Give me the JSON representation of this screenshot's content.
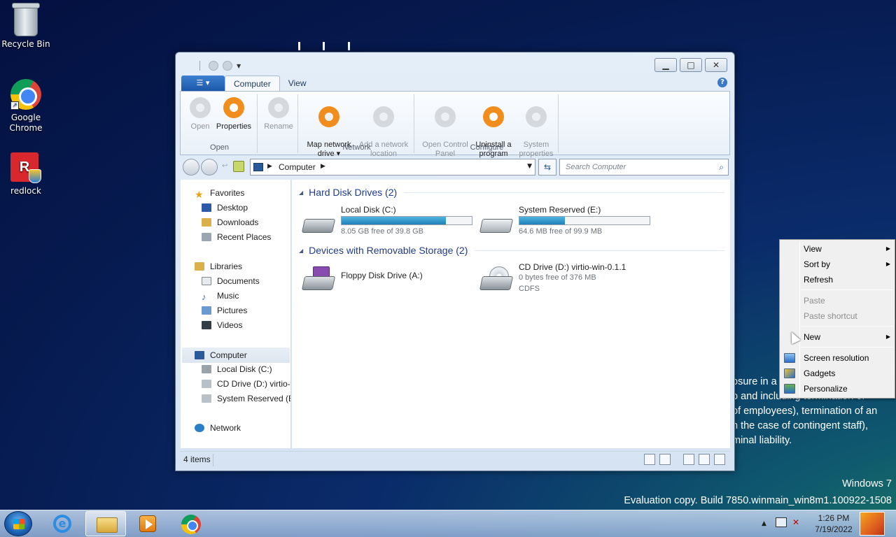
{
  "desktop": {
    "icons": [
      {
        "label": "Recycle Bin",
        "icon": "recycle-bin-icon"
      },
      {
        "label": "Google\nChrome",
        "icon": "chrome-icon"
      },
      {
        "label": "redlock",
        "icon": "redlock-icon"
      }
    ],
    "legal_text": [
      "osure in a",
      "o and including termination of",
      "of employees), termination of an",
      "n the case of contingent staff),",
      "minal liability."
    ],
    "watermark": {
      "line1": "Windows 7",
      "line2": "Evaluation copy. Build 7850.winmain_win8m1.100922-1508"
    }
  },
  "window": {
    "tabs": {
      "file": "▾",
      "computer": "Computer",
      "view": "View"
    },
    "ribbon": {
      "groups": [
        {
          "label": "Open",
          "buttons": [
            "Open",
            "Properties"
          ]
        },
        {
          "label": "",
          "buttons": [
            "Rename"
          ]
        },
        {
          "label": "Network",
          "buttons": [
            "Map network\ndrive ▾",
            "Add a network\nlocation"
          ]
        },
        {
          "label": "Configure",
          "buttons": [
            "Open Control\nPanel",
            "Uninstall a\nprogram",
            "System\nproperties"
          ]
        }
      ]
    },
    "address": {
      "path": "Computer",
      "search_placeholder": "Search Computer"
    },
    "nav": {
      "favorites": "Favorites",
      "desktop": "Desktop",
      "downloads": "Downloads",
      "recent": "Recent Places",
      "libraries": "Libraries",
      "documents": "Documents",
      "music": "Music",
      "pictures": "Pictures",
      "videos": "Videos",
      "computer": "Computer",
      "local_disk": "Local Disk (C:)",
      "cd_drive": "CD Drive (D:) virtio-w",
      "system_reserved": "System Reserved (E:)",
      "network": "Network"
    },
    "sections": {
      "hdd": "Hard Disk Drives (2)",
      "removable": "Devices with Removable Storage (2)"
    },
    "drives": {
      "c": {
        "name": "Local Disk (C:)",
        "free": "8.05 GB free of 39.8 GB",
        "used_fraction": 0.8
      },
      "e": {
        "name": "System Reserved (E:)",
        "free": "64.6 MB free of 99.9 MB",
        "used_fraction": 0.35
      },
      "a": {
        "name": "Floppy Disk Drive (A:)"
      },
      "d": {
        "name": "CD Drive (D:) virtio-win-0.1.1",
        "free": "0 bytes free of 376 MB",
        "fs": "CDFS"
      }
    },
    "status": {
      "items": "4 items"
    }
  },
  "context_menu": {
    "view": "View",
    "sort_by": "Sort by",
    "refresh": "Refresh",
    "paste": "Paste",
    "paste_shortcut": "Paste shortcut",
    "new": "New",
    "screen_resolution": "Screen resolution",
    "gadgets": "Gadgets",
    "personalize": "Personalize"
  },
  "taskbar": {
    "time": "1:26 PM",
    "date": "7/19/2022",
    "ie_glyph": "e"
  }
}
